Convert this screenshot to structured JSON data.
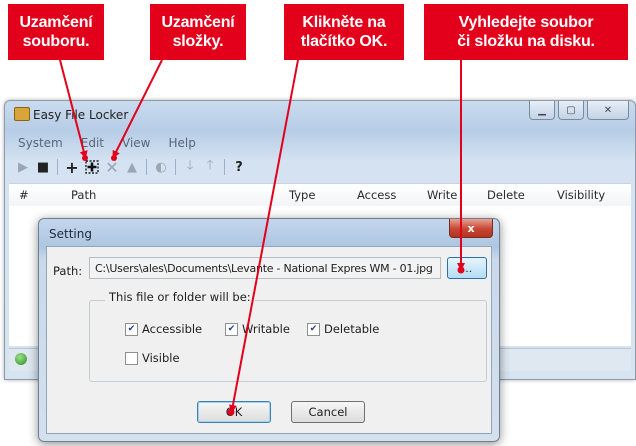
{
  "callouts": {
    "lock_file": "Uzamčení\nsouboru.",
    "lock_folder": "Uzamčení\nsložky.",
    "click_ok": "Klikněte na\ntlačítko OK.",
    "find_file": "Vyhledejte soubor\nči složku na disku."
  },
  "window": {
    "title": "Easy File Locker",
    "menu": [
      "System",
      "Edit",
      "View",
      "Help"
    ],
    "toolbar_help": "?",
    "columns": [
      "#",
      "Path",
      "Type",
      "Access",
      "Write",
      "Delete",
      "Visibility"
    ]
  },
  "dialog": {
    "title": "Setting",
    "close": "x",
    "path_label": "Path:",
    "path_value": "C:\\Users\\ales\\Documents\\Levante - National Expres WM - 01.jpg",
    "browse_label": "...",
    "group_caption": "This file or folder will be:",
    "options": {
      "accessible": "Accessible",
      "writable": "Writable",
      "deletable": "Deletable",
      "visible": "Visible"
    },
    "checked": {
      "accessible": true,
      "writable": true,
      "deletable": true,
      "visible": false
    },
    "ok_label": "OK",
    "cancel_label": "Cancel"
  },
  "colors": {
    "callout_red": "#e3001b"
  }
}
